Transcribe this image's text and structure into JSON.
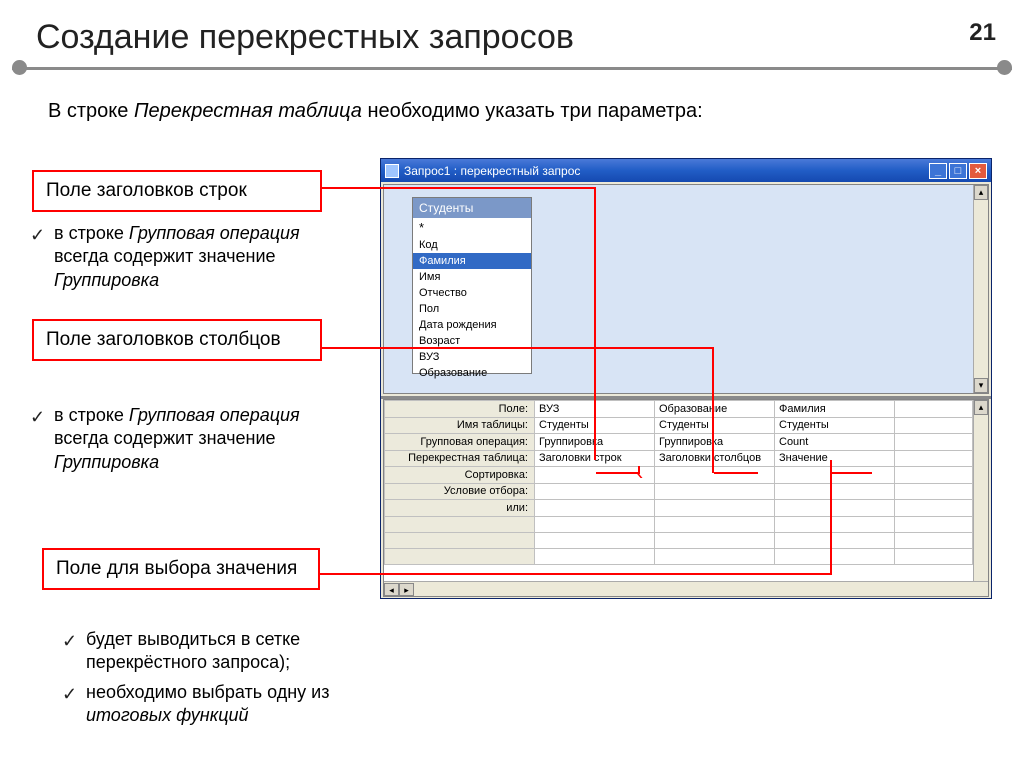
{
  "page": {
    "title": "Создание перекрестных запросов",
    "pgnum": "21",
    "subtitle_a": "В строке ",
    "subtitle_em": "Перекрестная таблица",
    "subtitle_b": " необходимо указать три параметра:"
  },
  "boxes": {
    "rows": "Поле заголовков строк",
    "cols": "Поле заголовков столбцов",
    "val": "Поле для выбора значения"
  },
  "bullets": {
    "t1a": "в строке ",
    "t1em": "Групповая операция",
    "t1b": " всегда содержит значение ",
    "t1em2": "Группировка",
    "t2a": "в строке ",
    "t2em": "Групповая операция",
    "t2b": " всегда содержит значение ",
    "t2em2": "Группировка",
    "t3a": "будет выводиться в сетке перекрёстного запроса);",
    "t3b": "необходимо выбрать одну из ",
    "t3em": "итоговых функций"
  },
  "win": {
    "title": "Запрос1 : перекрестный запрос"
  },
  "table": {
    "name": "Студенты",
    "fields": [
      "*",
      "Код",
      "Фамилия",
      "Имя",
      "Отчество",
      "Пол",
      "Дата рождения",
      "Возраст",
      "ВУЗ",
      "Образование"
    ]
  },
  "grid": {
    "labels": [
      "Поле:",
      "Имя таблицы:",
      "Групповая операция:",
      "Перекрестная таблица:",
      "Сортировка:",
      "Условие отбора:",
      "или:"
    ],
    "cols": [
      {
        "f": "ВУЗ",
        "t": "Студенты",
        "g": "Группировка",
        "x": "Заголовки строк"
      },
      {
        "f": "Образование",
        "t": "Студенты",
        "g": "Группировка",
        "x": "Заголовки столбцов"
      },
      {
        "f": "Фамилия",
        "t": "Студенты",
        "g": "Count",
        "x": "Значение"
      }
    ]
  }
}
